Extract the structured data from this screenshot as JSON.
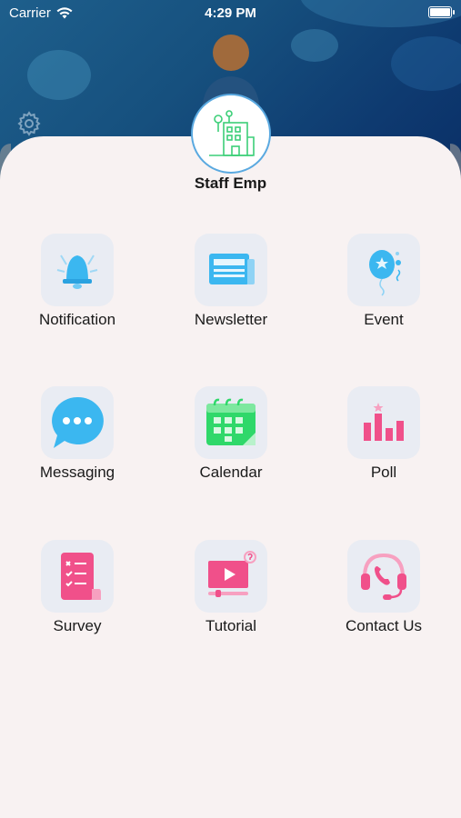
{
  "status_bar": {
    "carrier": "Carrier",
    "time": "4:29 PM"
  },
  "organization": {
    "name": "Staff Emp"
  },
  "menu": [
    {
      "label": "Notification",
      "icon": "bell-icon",
      "color": "#3bb7f0"
    },
    {
      "label": "Newsletter",
      "icon": "newspaper-icon",
      "color": "#3bb7f0"
    },
    {
      "label": "Event",
      "icon": "balloon-icon",
      "color": "#3bb7f0"
    },
    {
      "label": "Messaging",
      "icon": "chat-bubble-icon",
      "color": "#3bb7f0"
    },
    {
      "label": "Calendar",
      "icon": "calendar-icon",
      "color": "#2fd86a"
    },
    {
      "label": "Poll",
      "icon": "bar-chart-icon",
      "color": "#f0508a"
    },
    {
      "label": "Survey",
      "icon": "checklist-icon",
      "color": "#f0508a"
    },
    {
      "label": "Tutorial",
      "icon": "video-player-icon",
      "color": "#f0508a"
    },
    {
      "label": "Contact Us",
      "icon": "phone-headset-icon",
      "color": "#f0508a"
    }
  ]
}
